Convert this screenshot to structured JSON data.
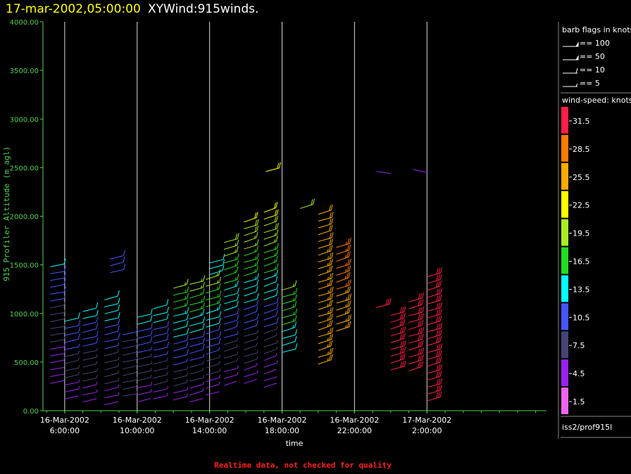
{
  "header": {
    "date": "17-mar-2002,05:00:00",
    "title": "XYWind:915winds."
  },
  "footer": {
    "note": "Realtime data, not checked for quality"
  },
  "platform_label": "iss2/prof915l",
  "barb_legend": {
    "title": "barb flags in knots",
    "entries": [
      {
        "label": "== 100",
        "knots": 100
      },
      {
        "label": "== 50",
        "knots": 50
      },
      {
        "label": "== 10",
        "knots": 10
      },
      {
        "label": "== 5",
        "knots": 5
      }
    ]
  },
  "color_legend": {
    "title": "wind-speed: knots",
    "levels": [
      {
        "label": "31.5",
        "color": "#ff1e46"
      },
      {
        "label": "28.5",
        "color": "#ff7a00"
      },
      {
        "label": "25.5",
        "color": "#ffaa00"
      },
      {
        "label": "22.5",
        "color": "#ffff00"
      },
      {
        "label": "19.5",
        "color": "#aaee22"
      },
      {
        "label": "16.5",
        "color": "#22dd22"
      },
      {
        "label": "13.5",
        "color": "#00ffff"
      },
      {
        "label": "10.5",
        "color": "#4455ff"
      },
      {
        "label": "7.5",
        "color": "#444477"
      },
      {
        "label": "4.5",
        "color": "#9922ee"
      },
      {
        "label": "1.5",
        "color": "#ee66ee"
      }
    ]
  },
  "chart_data": {
    "type": "scatter",
    "title": "XYWind:915winds.",
    "xlabel": "time",
    "ylabel": "915 Profiler Altitude (m agl)",
    "ylim": [
      0,
      4000
    ],
    "xlim_hours": [
      4.8,
      32.6
    ],
    "grid": "vertical",
    "x_ticks": [
      {
        "date": "16-Mar-2002",
        "time": "6:00:00",
        "hour": 6
      },
      {
        "date": "16-Mar-2002",
        "time": "10:00:00",
        "hour": 10
      },
      {
        "date": "16-Mar-2002",
        "time": "14:00:00",
        "hour": 14
      },
      {
        "date": "16-Mar-2002",
        "time": "18:00:00",
        "hour": 18
      },
      {
        "date": "16-Mar-2002",
        "time": "22:00:00",
        "hour": 22
      },
      {
        "date": "17-Mar-2002",
        "time": "2:00:00",
        "hour": 26
      }
    ],
    "y_ticks": [
      "0.00",
      "500.00",
      "1000.00",
      "1500.00",
      "2000.00",
      "2500.00",
      "3000.00",
      "3500.00",
      "4000.00"
    ],
    "y_tick_values": [
      0,
      500,
      1000,
      1500,
      2000,
      2500,
      3000,
      3500,
      4000
    ],
    "profiles": [
      {
        "hour": 5.2,
        "base": 280,
        "top": 1480,
        "s0": 3,
        "s1": 12,
        "dir": 265
      },
      {
        "hour": 6.0,
        "base": 120,
        "top": 920,
        "s0": 4,
        "s1": 12,
        "dir": 260
      },
      {
        "hour": 7.0,
        "base": 90,
        "top": 1020,
        "s0": 4,
        "s1": 13,
        "dir": 258
      },
      {
        "hour": 8.2,
        "base": 60,
        "top": 1140,
        "s0": 4,
        "s1": 14,
        "dir": 255
      },
      {
        "hour": 8.5,
        "base": 1420,
        "top": 1560,
        "s0": 11,
        "s1": 11,
        "dir": 255
      },
      {
        "hour": 9.2,
        "base": 150,
        "top": 780,
        "s0": 6,
        "s1": 9,
        "dir": 262
      },
      {
        "hour": 10.0,
        "base": 90,
        "top": 960,
        "s0": 4,
        "s1": 13,
        "dir": 258
      },
      {
        "hour": 10.9,
        "base": 120,
        "top": 1050,
        "s0": 5,
        "s1": 14,
        "dir": 256
      },
      {
        "hour": 12.0,
        "base": 110,
        "top": 1260,
        "s0": 5,
        "s1": 18,
        "dir": 254
      },
      {
        "hour": 12.9,
        "base": 90,
        "top": 1300,
        "s0": 4,
        "s1": 19,
        "dir": 252
      },
      {
        "hour": 13.8,
        "base": 160,
        "top": 1350,
        "s0": 4,
        "s1": 19,
        "dir": 250
      },
      {
        "hour": 14.0,
        "base": 1400,
        "top": 1520,
        "s0": 12,
        "s1": 12,
        "dir": 252
      },
      {
        "hour": 14.8,
        "base": 260,
        "top": 1730,
        "s0": 4,
        "s1": 20,
        "dir": 248
      },
      {
        "hour": 15.9,
        "base": 280,
        "top": 1940,
        "s0": 4,
        "s1": 21,
        "dir": 246
      },
      {
        "hour": 17.0,
        "base": 240,
        "top": 2040,
        "s0": 3,
        "s1": 22,
        "dir": 244
      },
      {
        "hour": 17.1,
        "base": 2460,
        "top": 2490,
        "s0": 23,
        "s1": 23,
        "dir": 250
      },
      {
        "hour": 18.0,
        "base": 600,
        "top": 1240,
        "s0": 13,
        "s1": 18,
        "dir": 250
      },
      {
        "hour": 19.0,
        "base": 2080,
        "top": 2110,
        "s0": 20,
        "s1": 20,
        "dir": 250
      },
      {
        "hour": 20.0,
        "base": 480,
        "top": 2020,
        "s0": 26,
        "s1": 24,
        "dir": 248
      },
      {
        "hour": 21.0,
        "base": 820,
        "top": 1680,
        "s0": 26,
        "s1": 28,
        "dir": 246
      },
      {
        "hour": 23.2,
        "base": 1060,
        "top": 1080,
        "s0": 31,
        "s1": 31,
        "dir": 250
      },
      {
        "hour": 24.0,
        "base": 420,
        "top": 980,
        "s0": 31,
        "s1": 32,
        "dir": 250
      },
      {
        "hour": 25.0,
        "base": 410,
        "top": 1120,
        "s0": 31,
        "s1": 32,
        "dir": 250
      },
      {
        "hour": 26.0,
        "base": 100,
        "top": 1380,
        "s0": 30,
        "s1": 33,
        "dir": 252
      },
      {
        "hour": 24.0,
        "base": 2440,
        "top": 2440,
        "s0": 3,
        "s1": 3,
        "dir": 90
      },
      {
        "hour": 26.0,
        "base": 2450,
        "top": 2450,
        "s0": 3,
        "s1": 3,
        "dir": 100
      }
    ]
  }
}
